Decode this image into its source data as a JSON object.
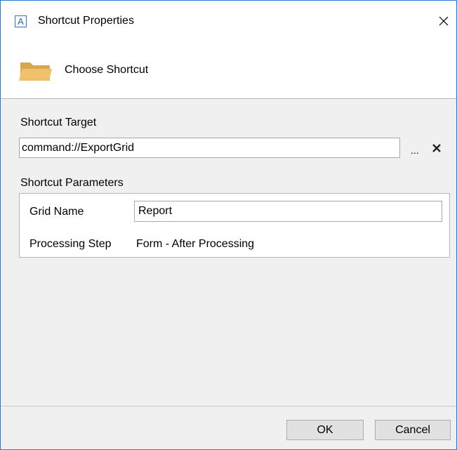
{
  "window": {
    "title": "Shortcut Properties",
    "app_icon_letter": "A",
    "close_glyph": "✕"
  },
  "header": {
    "title": "Choose Shortcut",
    "icon": "folder-icon"
  },
  "target": {
    "label": "Shortcut Target",
    "value": "command://ExportGrid",
    "browse_label": "...",
    "clear_icon": "clear-x-icon"
  },
  "parameters": {
    "label": "Shortcut Parameters",
    "grid_name_label": "Grid Name",
    "grid_name_value": "Report",
    "processing_step_label": "Processing Step",
    "processing_step_value": "Form - After Processing"
  },
  "footer": {
    "ok_label": "OK",
    "cancel_label": "Cancel"
  },
  "colors": {
    "accent": "#2b79d6",
    "folder": "#e8b55a"
  }
}
